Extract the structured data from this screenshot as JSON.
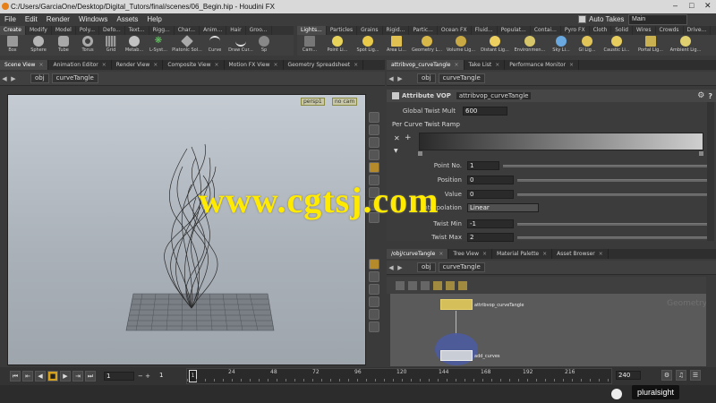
{
  "window": {
    "title": "C:/Users/GarciaOne/Desktop/Digital_Tutors/final/scenes/06_Begin.hip - Houdini FX"
  },
  "menu": {
    "items": [
      "File",
      "Edit",
      "Render",
      "Windows",
      "Assets",
      "Help"
    ],
    "auto_takes_label": "Auto Takes",
    "desktop": "Main"
  },
  "shelf_left": {
    "tabs": [
      "Create",
      "Modify",
      "Model",
      "Poly...",
      "Defo...",
      "Text...",
      "Rigg...",
      "Char...",
      "Anim...",
      "Hair",
      "Groo..."
    ],
    "tools": [
      "Box",
      "Sphere",
      "Tube",
      "Torus",
      "Grid",
      "Metab...",
      "L-Syst...",
      "Platonic Sol...",
      "Curve",
      "Draw Cur...",
      "Sp"
    ]
  },
  "shelf_right": {
    "tabs": [
      "Lights...",
      "Particles",
      "Grains",
      "Rigid...",
      "Partic...",
      "Ocean FX",
      "Fluid...",
      "Populat...",
      "Contai...",
      "Pyro FX",
      "Cloth",
      "Solid",
      "Wires",
      "Crowds",
      "Drive..."
    ],
    "tools": [
      "Cam...",
      "Point Li...",
      "Spot Lig...",
      "Area Li...",
      "Geometry L...",
      "Volume Lig...",
      "Distant Lig...",
      "Environmen...",
      "Sky Li...",
      "GI Lig...",
      "Caustic Li...",
      "Portal Lig...",
      "Ambient Lig..."
    ]
  },
  "left_pane": {
    "tabs": [
      "Scene View",
      "Animation Editor",
      "Render View",
      "Composite View",
      "Motion FX View",
      "Geometry Spreadsheet"
    ],
    "path": [
      "obj",
      "curveTangle"
    ],
    "view_camera": "persp1",
    "view_cam_btn": "no cam"
  },
  "right_top_pane": {
    "tabs": [
      "attribvop_curveTangle",
      "Take List",
      "Performance Monitor"
    ],
    "path": [
      "obj",
      "curveTangle"
    ],
    "node_type": "Attribute VOP",
    "node_name": "attribvop_curveTangle",
    "params": {
      "global_twist_mult_label": "Global Twist Mult",
      "global_twist_mult": "600",
      "ramp_label": "Per Curve Twist Ramp",
      "point_no_label": "Point No.",
      "point_no": "1",
      "position_label": "Position",
      "position": "0",
      "value_label": "Value",
      "value": "0",
      "interp_label": "Interpolation",
      "interp": "Linear",
      "twist_min_label": "Twist Min",
      "twist_min": "-1",
      "twist_max_label": "Twist Max",
      "twist_max": "2"
    }
  },
  "right_bottom_pane": {
    "tabs": [
      "/obj/curveTangle",
      "Tree View",
      "Material Palette",
      "Asset Browser"
    ],
    "path": [
      "obj",
      "curveTangle"
    ],
    "network_label": "Geometry",
    "nodes": [
      "attribvop_curveTangle",
      "add_curves"
    ]
  },
  "timeline": {
    "start_frame": "1",
    "current_frame": "1",
    "range_start": "1",
    "ticks": [
      "24",
      "48",
      "72",
      "96",
      "120",
      "144",
      "168",
      "192",
      "216"
    ],
    "end_frame": "240"
  },
  "branding": {
    "watermark": "www.cgtsj.com",
    "pluralsight": "pluralsight"
  },
  "colors": {
    "accent": "#d4bf5a",
    "watermark": "#ffea00"
  }
}
